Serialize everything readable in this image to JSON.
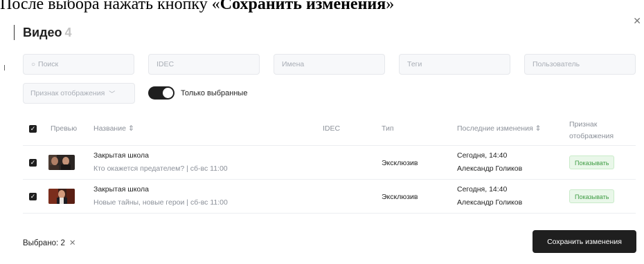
{
  "instruction": {
    "prefix": "После выбора нажать кнопку «",
    "bold": "Сохранить изменения",
    "suffix": "»"
  },
  "modal": {
    "title": "Видео",
    "count": "4",
    "close_icon": "close-icon"
  },
  "filters": {
    "search_placeholder": "Поиск",
    "idec_placeholder": "IDEC",
    "names_placeholder": "Имена",
    "tags_placeholder": "Теги",
    "user_placeholder": "Пользователь",
    "display_select": "Признак отображения",
    "only_selected_label": "Только выбранные",
    "only_selected_on": true
  },
  "table": {
    "headers": {
      "preview": "Превью",
      "name": "Название ⇕",
      "idec": "IDEC",
      "type": "Тип",
      "last_changes": "Последние изменения ⇕",
      "display_line1": "Признак",
      "display_line2": "отображения"
    },
    "rows": [
      {
        "checked": true,
        "title": "Закрытая школа",
        "subtitle": "Кто окажется предателем? | сб-вс 11:00",
        "idec": "",
        "type": "Эксклюзив",
        "changed_at": "Сегодня, 14:40",
        "changed_by": "Александр Голиков",
        "display": "Показывать"
      },
      {
        "checked": true,
        "title": "Закрытая школа",
        "subtitle": "Новые тайны, новые герои | сб-вс 11:00",
        "idec": "",
        "type": "Эксклюзив",
        "changed_at": "Сегодня, 14:40",
        "changed_by": "Александр Голиков",
        "display": "Показывать"
      }
    ]
  },
  "footer": {
    "selected_label": "Выбрано: 2",
    "clear_icon": "close-icon",
    "save_label": "Сохранить изменения"
  },
  "colors": {
    "primary": "#1f1f1f",
    "badge_text": "#3e9c43",
    "badge_bg": "#e9f7e9"
  }
}
